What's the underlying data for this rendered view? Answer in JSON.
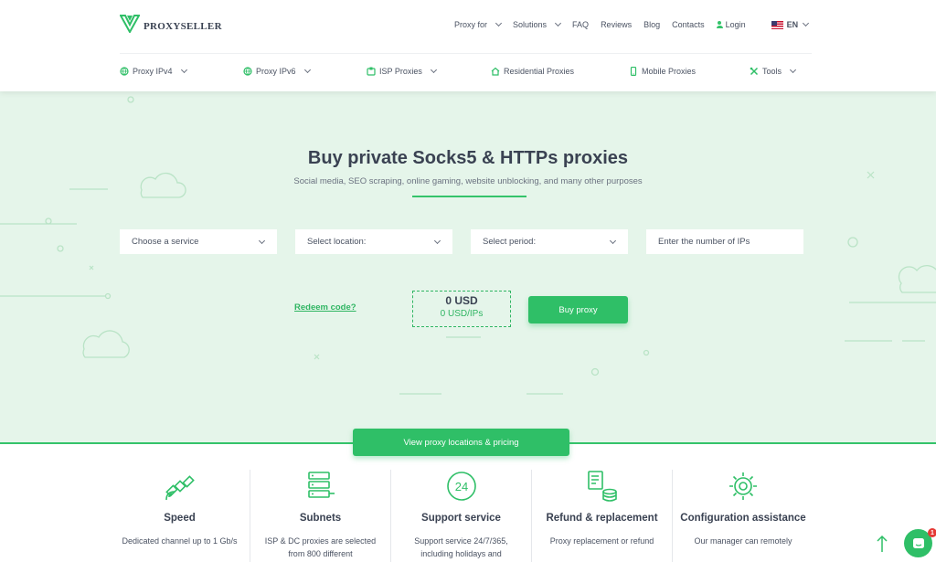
{
  "brand": {
    "name": "PROXYSELLER"
  },
  "top_nav": [
    {
      "label": "Proxy for",
      "dropdown": true
    },
    {
      "label": "Solutions",
      "dropdown": true
    },
    {
      "label": "FAQ"
    },
    {
      "label": "Reviews"
    },
    {
      "label": "Blog"
    },
    {
      "label": "Contacts"
    }
  ],
  "login_label": "Login",
  "language": "EN",
  "sub_nav": [
    {
      "label": "Proxy IPv4",
      "icon": "globe-icon",
      "dropdown": true
    },
    {
      "label": "Proxy IPv6",
      "icon": "globe-icon",
      "dropdown": true
    },
    {
      "label": "ISP Proxies",
      "icon": "isp-icon",
      "dropdown": true
    },
    {
      "label": "Residential Proxies",
      "icon": "home-icon"
    },
    {
      "label": "Mobile Proxies",
      "icon": "mobile-icon"
    },
    {
      "label": "Tools",
      "icon": "tools-icon",
      "dropdown": true
    }
  ],
  "hero": {
    "title": "Buy private Socks5 & HTTPs proxies",
    "subtitle": "Social media, SEO scraping, online gaming, website unblocking, and many other purposes"
  },
  "form": {
    "service_placeholder": "Choose a service",
    "location_placeholder": "Select location:",
    "period_placeholder": "Select period:",
    "ips_placeholder": "Enter the number of IPs",
    "redeem_label": "Redeem code?",
    "price": "0 USD",
    "price_per_ip": "0 USD/IPs",
    "buy_label": "Buy proxy"
  },
  "view_pricing_label": "View proxy locations & pricing",
  "features": [
    {
      "icon": "satellite-icon",
      "title": "Speed",
      "text": "Dedicated channel up to 1 Gb/s"
    },
    {
      "icon": "servers-icon",
      "title": "Subnets",
      "text": "ISP & DC proxies are selected from 800 different"
    },
    {
      "icon": "support-24-icon",
      "title": "Support service",
      "text": "Support service 24/7/365, including holidays and"
    },
    {
      "icon": "refund-icon",
      "title": "Refund & replacement",
      "text": "Proxy replacement or refund"
    },
    {
      "icon": "gear-icon",
      "title": "Configuration assistance",
      "text": "Our manager can remotely"
    }
  ],
  "chat_badge": "1",
  "colors": {
    "accent": "#2fbf67",
    "hero_bg": "#e5f5ea",
    "text": "#3a4252"
  }
}
